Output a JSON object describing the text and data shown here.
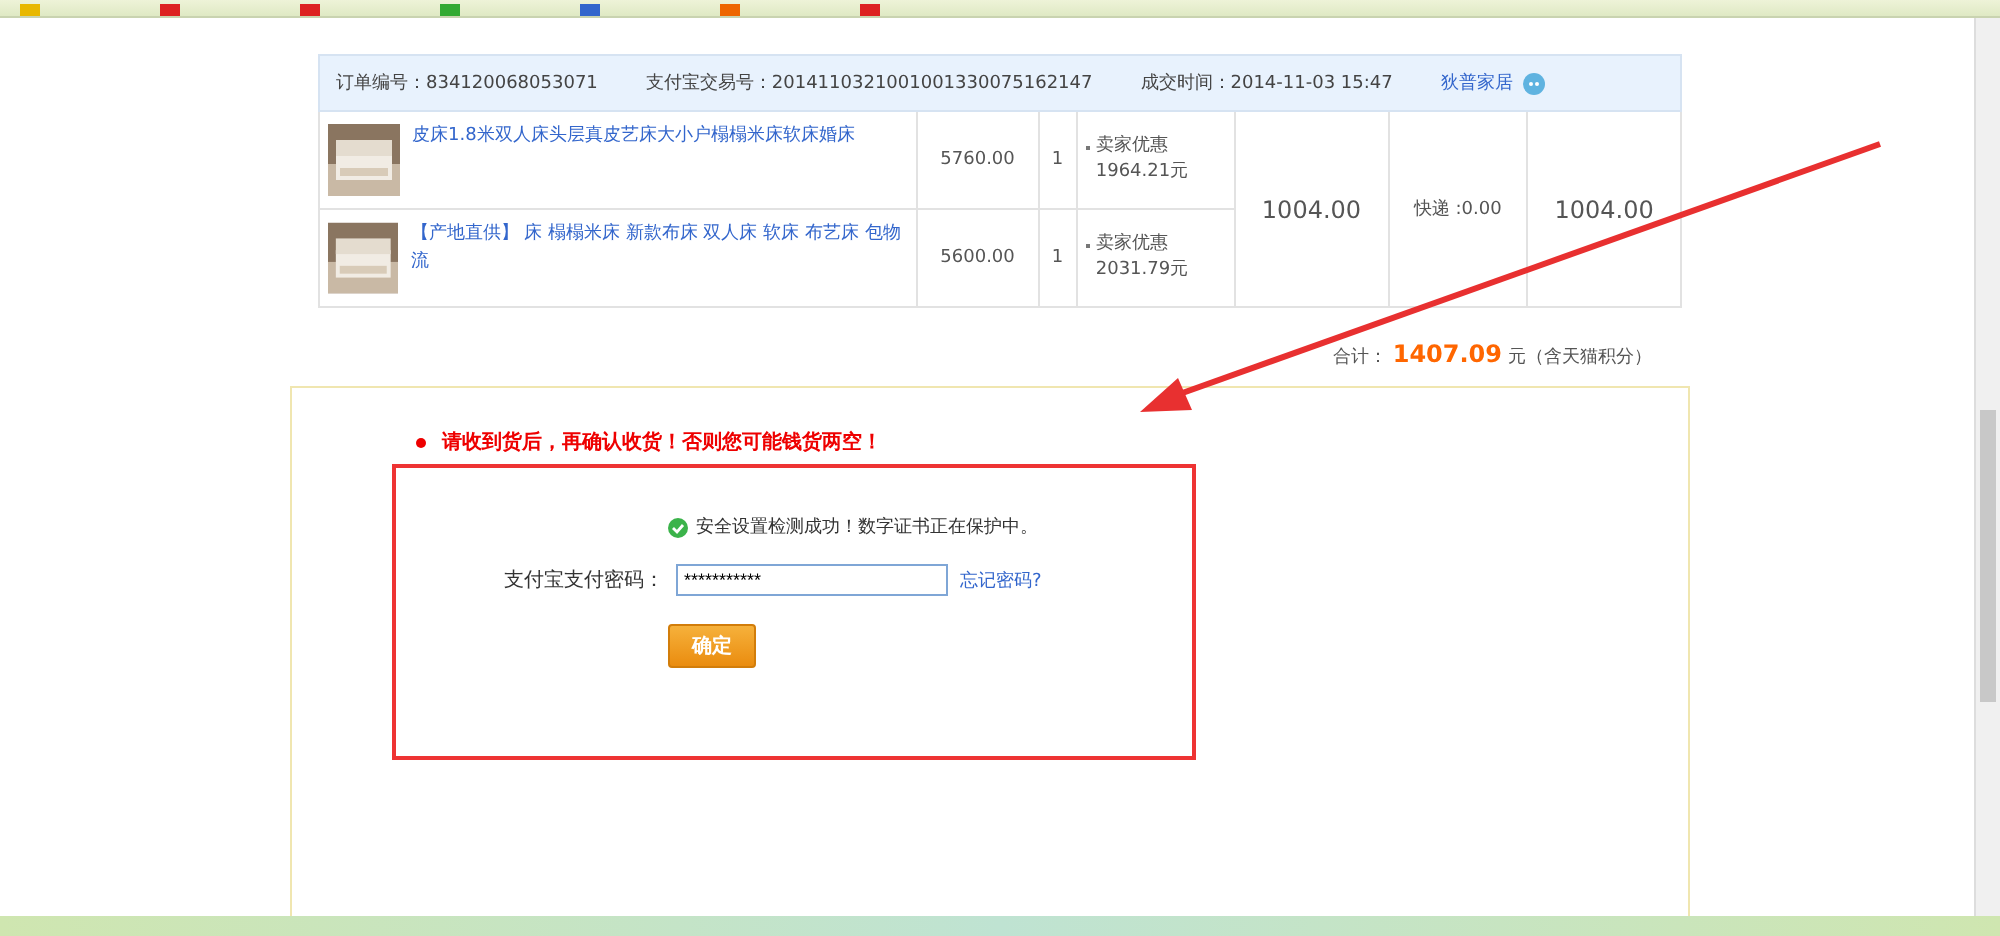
{
  "order": {
    "order_no_label": "订单编号：",
    "order_no": "834120068053071",
    "trade_no_label": "支付宝交易号：",
    "trade_no": "2014110321001001330075162147",
    "time_label": "成交时间：",
    "time": "2014-11-03 15:47",
    "shop": "狄普家居",
    "items": [
      {
        "title": "皮床1.8米双人床头层真皮艺床大小户榻榻米床软床婚床",
        "price": "5760.00",
        "qty": "1",
        "discount_label": "卖家优惠",
        "discount": "1964.21元"
      },
      {
        "title": "【产地直供】 床 榻榻米床 新款布床 双人床 软床 布艺床 包物流",
        "price": "5600.00",
        "qty": "1",
        "discount_label": "卖家优惠",
        "discount": "2031.79元"
      }
    ],
    "amount": "1004.00",
    "shipping": "快递 :0.00",
    "total": "1004.00"
  },
  "sum": {
    "label": "合计：",
    "value": "1407.09",
    "unit": "元（含天猫积分）"
  },
  "confirm": {
    "warning": "请收到货后，再确认收货！否则您可能钱货两空！",
    "security": "安全设置检测成功！数字证书正在保护中。",
    "password_label": "支付宝支付密码：",
    "password_value": "***********",
    "forgot": "忘记密码?",
    "submit": "确定"
  }
}
